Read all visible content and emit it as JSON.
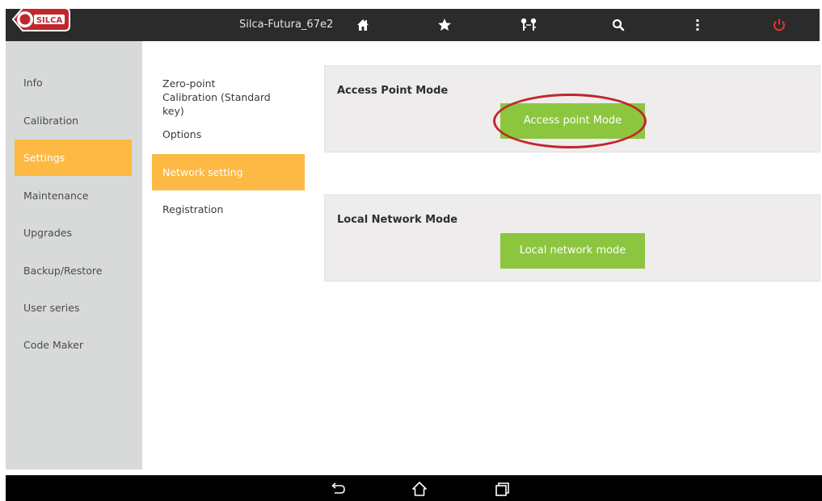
{
  "header": {
    "device_name": "Silca-Futura_67e2",
    "logo_text": "SILCA",
    "icons": [
      "home-icon",
      "star-icon",
      "keys-icon",
      "search-icon",
      "more-icon",
      "power-icon"
    ]
  },
  "sidebar": {
    "items": [
      {
        "label": "Info"
      },
      {
        "label": "Calibration"
      },
      {
        "label": "Settings"
      },
      {
        "label": "Maintenance"
      },
      {
        "label": "Upgrades"
      },
      {
        "label": "Backup/Restore"
      },
      {
        "label": "User series"
      },
      {
        "label": "Code Maker"
      }
    ],
    "active": "Settings"
  },
  "submenu": {
    "items": [
      {
        "label": "Zero-point Calibration (Standard key)"
      },
      {
        "label": "Options"
      },
      {
        "label": "Network setting"
      },
      {
        "label": "Registration"
      }
    ],
    "active": "Network setting"
  },
  "main": {
    "access_point": {
      "title": "Access Point Mode",
      "button_label": "Access point Mode"
    },
    "local_network": {
      "title": "Local Network Mode",
      "button_label": "Local network mode"
    }
  },
  "navbar": {
    "icons": [
      "back-icon",
      "home-outline-icon",
      "recent-apps-icon"
    ]
  },
  "colors": {
    "accent": "#fdb943",
    "button_green": "#8cc63e",
    "highlight_red": "#c0272d",
    "topbar": "#2b2b2b",
    "power_red": "#e8342f"
  }
}
